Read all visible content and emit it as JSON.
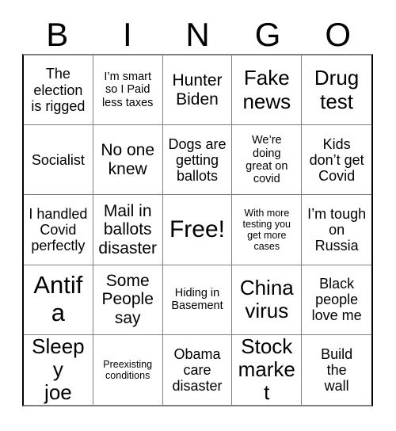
{
  "card": {
    "header_letters": [
      "B",
      "I",
      "N",
      "G",
      "O"
    ],
    "columns": 5,
    "rows": 5,
    "border_color": "#808080",
    "outer_border_color": "#000000",
    "background_color": "#ffffff",
    "text_color": "#000000",
    "free_space_index": 12,
    "free_space_label": "Free!"
  },
  "squares": [
    {
      "text": "The\nelection\nis rigged",
      "size": "md"
    },
    {
      "text": "I’m smart\nso I Paid\nless taxes",
      "size": "sm"
    },
    {
      "text": "Hunter\nBiden",
      "size": "lg"
    },
    {
      "text": "Fake\nnews",
      "size": "xl"
    },
    {
      "text": "Drug\ntest",
      "size": "xl"
    },
    {
      "text": "Socialist",
      "size": "md"
    },
    {
      "text": "No one\nknew",
      "size": "lg"
    },
    {
      "text": "Dogs are\ngetting\nballots",
      "size": "md"
    },
    {
      "text": "We’re\ndoing\ngreat on\ncovid",
      "size": "sm"
    },
    {
      "text": "Kids\ndon’t get\nCovid",
      "size": "md"
    },
    {
      "text": "I handled\nCovid\nperfectly",
      "size": "md"
    },
    {
      "text": "Mail in\nballots\ndisaster",
      "size": "lg"
    },
    {
      "text": "Free!",
      "size": "free"
    },
    {
      "text": "With more\ntesting you\nget more\ncases",
      "size": "xs"
    },
    {
      "text": "I’m tough\non\nRussia",
      "size": "md"
    },
    {
      "text": "Antifa",
      "size": "xxl"
    },
    {
      "text": "Some\nPeople\nsay",
      "size": "lg"
    },
    {
      "text": "Hiding in\nBasement",
      "size": "sm"
    },
    {
      "text": "China\nvirus",
      "size": "xl"
    },
    {
      "text": "Black\npeople\nlove me",
      "size": "md"
    },
    {
      "text": "Sleepy\njoe",
      "size": "xl"
    },
    {
      "text": "Preexisting\nconditions",
      "size": "xs"
    },
    {
      "text": "Obama\ncare\ndisaster",
      "size": "md"
    },
    {
      "text": "Stock\nmarket",
      "size": "xl"
    },
    {
      "text": "Build\nthe\nwall",
      "size": "md"
    }
  ]
}
